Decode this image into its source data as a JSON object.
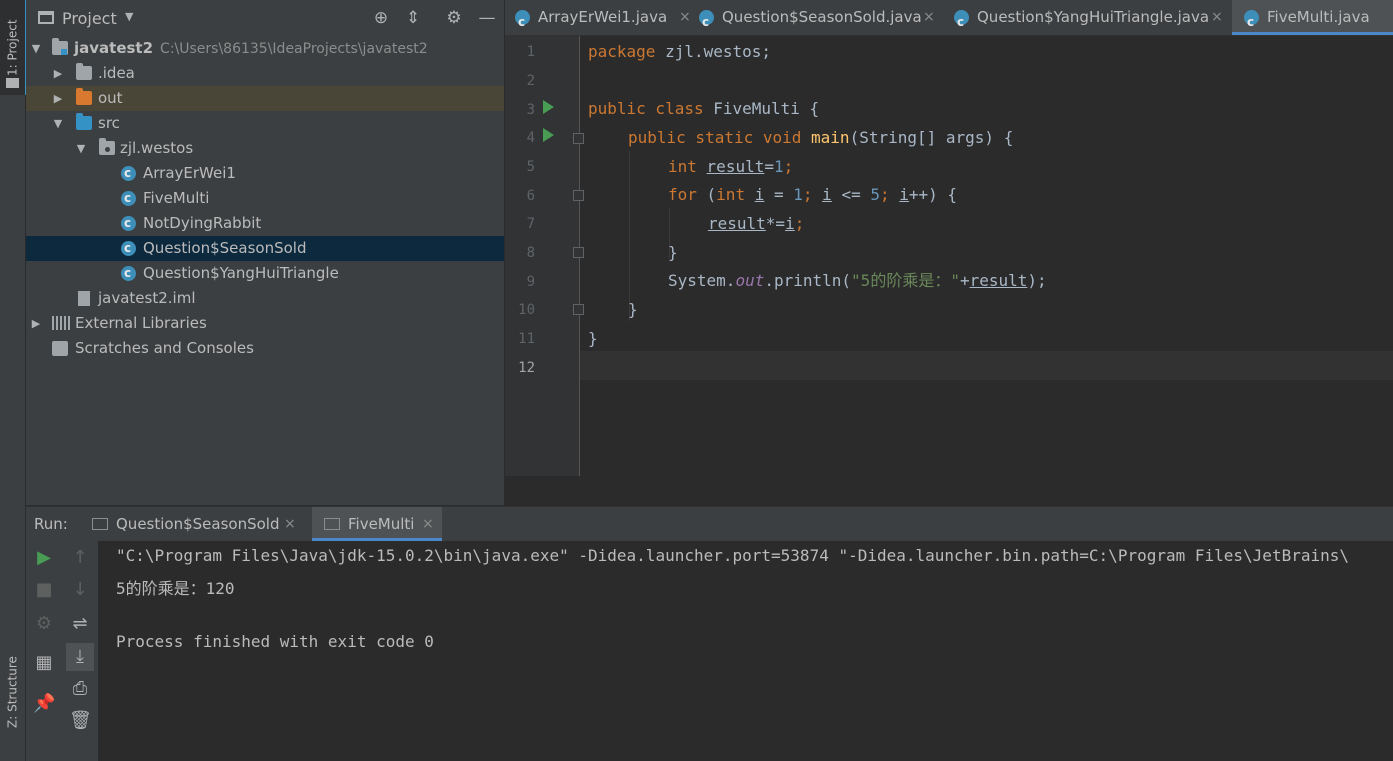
{
  "side_tabs": {
    "project": "1: Project",
    "structure": "Z: Structure"
  },
  "project_panel": {
    "title": "Project",
    "tree": [
      {
        "label": "javatest2",
        "path": "C:\\Users\\86135\\IdeaProjects\\javatest2",
        "icon": "module-folder-icon"
      },
      {
        "label": ".idea",
        "icon": "folder-icon"
      },
      {
        "label": "out",
        "icon": "excluded-folder-icon"
      },
      {
        "label": "src",
        "icon": "source-folder-icon"
      },
      {
        "label": "zjl.westos",
        "icon": "package-icon"
      },
      {
        "label": "ArrayErWei1",
        "icon": "java-class-icon"
      },
      {
        "label": "FiveMulti",
        "icon": "java-class-icon"
      },
      {
        "label": "NotDyingRabbit",
        "icon": "java-class-icon"
      },
      {
        "label": "Question$SeasonSold",
        "icon": "java-class-icon"
      },
      {
        "label": "Question$YangHuiTriangle",
        "icon": "java-class-icon"
      },
      {
        "label": "javatest2.iml",
        "icon": "iml-file-icon"
      },
      {
        "label": "External Libraries",
        "icon": "libraries-icon"
      },
      {
        "label": "Scratches and Consoles",
        "icon": "scratches-icon"
      }
    ],
    "selected": "Question$SeasonSold"
  },
  "editor_tabs": [
    {
      "label": "ArrayErWei1.java",
      "active": false
    },
    {
      "label": "Question$SeasonSold.java",
      "active": false
    },
    {
      "label": "Question$YangHuiTriangle.java",
      "active": false
    },
    {
      "label": "FiveMulti.java",
      "active": true
    }
  ],
  "close_glyph": "×",
  "editor": {
    "line_numbers": [
      "1",
      "2",
      "3",
      "4",
      "5",
      "6",
      "7",
      "8",
      "9",
      "10",
      "11",
      "12"
    ],
    "code": {
      "l1_kw": "package",
      "l1_rest": " zjl.westos;",
      "l3_kw": "public class",
      "l3_rest": " FiveMulti {",
      "l4_kw": "public static void",
      "l4_fn": "main",
      "l4_rest": "(String[] args) {",
      "l5_kw": "int",
      "l5_var": "result",
      "l5_eq": "=",
      "l5_num": "1",
      "l5_end": ";",
      "l6_kw": "for",
      "l6_p": " (",
      "l6_kw2": "int",
      "l6_sp": " ",
      "l6_i1": "i",
      "l6_a": " = ",
      "l6_n1": "1",
      "l6_b": "; ",
      "l6_i2": "i",
      "l6_c": " <= ",
      "l6_n2": "5",
      "l6_d": "; ",
      "l6_i3": "i",
      "l6_e": "++) {",
      "l7_var": "result",
      "l7_op": "*=",
      "l7_i": "i",
      "l7_end": ";",
      "l8": "}",
      "l9_a": "System.",
      "l9_fld": "out",
      "l9_b": ".println(",
      "l9_str": "\"5的阶乘是：\"",
      "l9_c": "+",
      "l9_var": "result",
      "l9_d": ");",
      "l10": "}",
      "l11": "}"
    }
  },
  "run_panel": {
    "label": "Run:",
    "tabs": [
      {
        "label": "Question$SeasonSold",
        "active": false
      },
      {
        "label": "FiveMulti",
        "active": true
      }
    ],
    "console": [
      "\"C:\\Program Files\\Java\\jdk-15.0.2\\bin\\java.exe\" -Didea.launcher.port=53874 \"-Didea.launcher.bin.path=C:\\Program Files\\JetBrains\\",
      "5的阶乘是：120",
      "",
      "Process finished with exit code 0"
    ]
  },
  "colors": {
    "accent": "#4a88c7",
    "selection": "#0d293e",
    "run_green": "#499c54",
    "excluded_folder": "#d9782f",
    "source_folder": "#3592c4"
  }
}
